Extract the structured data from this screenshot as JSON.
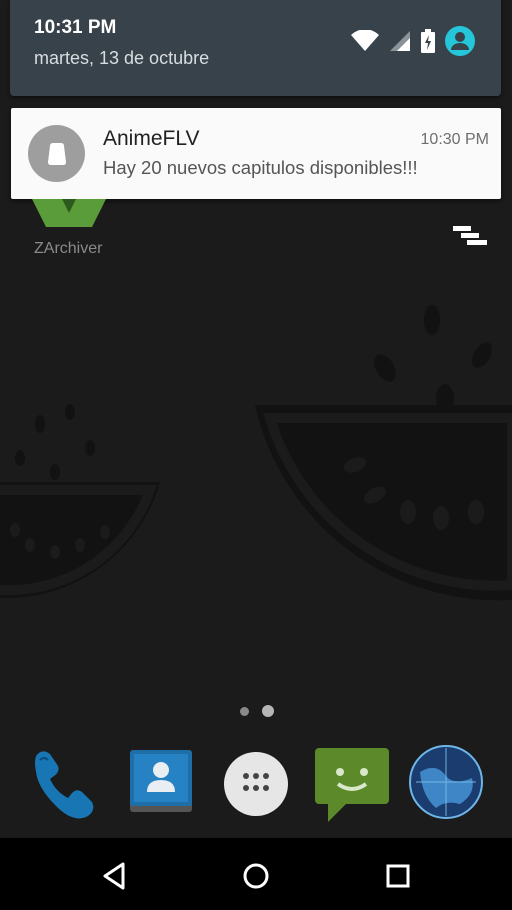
{
  "status": {
    "time": "10:31 PM",
    "date": "martes, 13 de octubre",
    "icons": [
      "wifi-icon",
      "signal-icon",
      "battery-charging-icon",
      "account-icon"
    ],
    "accent": "#26c6da"
  },
  "notification": {
    "app_name": "AnimeFLV",
    "time": "10:30 PM",
    "text": "Hay 20 nuevos capitulos disponibles!!!"
  },
  "home": {
    "apps": [
      {
        "label": "ZArchiver",
        "icon": "zarchiver-icon"
      }
    ],
    "menu_icon": "overflow-menu-icon",
    "pages": {
      "count": 2,
      "current": 2
    }
  },
  "dock": [
    {
      "icon": "phone-icon"
    },
    {
      "icon": "contacts-icon"
    },
    {
      "icon": "app-drawer-icon"
    },
    {
      "icon": "messaging-icon"
    },
    {
      "icon": "browser-globe-icon"
    }
  ],
  "nav": [
    "back-icon",
    "home-icon",
    "recents-icon"
  ]
}
